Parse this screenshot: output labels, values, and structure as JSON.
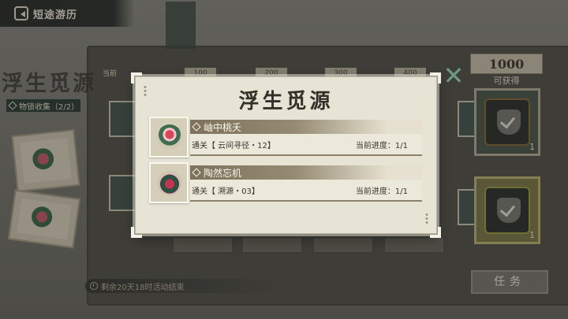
{
  "header": {
    "title": "短途游历"
  },
  "background": {
    "logo_text": "浮生觅源",
    "collection_tag": "物锁收集（2/2）",
    "current_label": "当前",
    "tier_values": [
      "100",
      "200",
      "300",
      "400"
    ],
    "timer_text": "剩余20天18时活动结束"
  },
  "rewards": {
    "count": "1000",
    "label": "可获得",
    "items": [
      {
        "qty": "1"
      },
      {
        "qty": "1"
      }
    ]
  },
  "task_button": "任务",
  "modal": {
    "title": "浮生觅源",
    "close_symbol": "✕",
    "items": [
      {
        "name": "岫中桃夭",
        "requirement": "通关【 云间寻径・12】",
        "progress": "当前进度：1/1"
      },
      {
        "name": "陶然忘机",
        "requirement": "通关【 溯源・03】",
        "progress": "当前进度：1/1"
      }
    ]
  },
  "colors": {
    "modal_bg": "#e7e3d5",
    "accent_teal": "#6c9a87",
    "header_bar": "#2a2f2b"
  }
}
